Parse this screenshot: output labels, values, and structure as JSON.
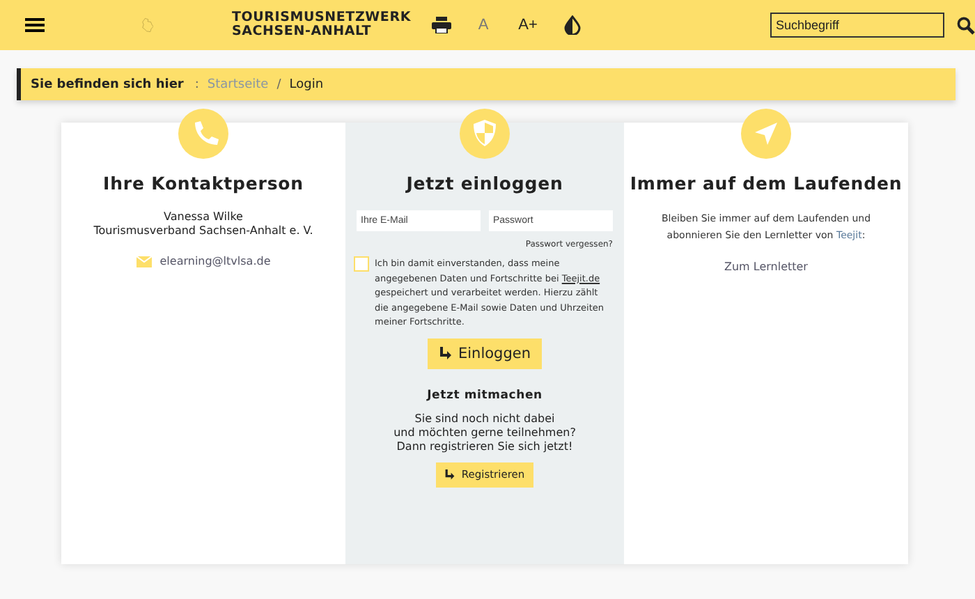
{
  "header": {
    "title_lines": [
      "TOURISMUSNETZWERK",
      "SACHSEN-ANHALT"
    ],
    "font_buttons": [
      "A",
      "A+"
    ],
    "search": {
      "placeholder": "Suchbegriff"
    }
  },
  "breadcrumb": {
    "label": "Sie befinden sich hier",
    "separator": ":",
    "items": [
      {
        "text": "Startseite",
        "kind": "link"
      },
      {
        "text": "/",
        "kind": "separator"
      },
      {
        "text": "Login",
        "kind": "current"
      }
    ]
  },
  "contact": {
    "title": "Ihre Kontaktperson",
    "lines": [
      "Vanessa Wilke",
      "Tourismusverband Sachsen-Anhalt e. V."
    ],
    "email": "elearning@ltvlsa.de"
  },
  "login": {
    "title": "Jetzt einloggen",
    "email_placeholder": "Ihre E-Mail",
    "password_placeholder": "Passwort",
    "forgot": "Passwort vergessen?",
    "consent": {
      "checked": false,
      "before": "Ich bin damit einverstanden, dass meine angegebenen Daten und Fortschritte bei ",
      "link": "Teejit.de",
      "after": " gespeichert und verarbeitet werden. Hierzu zählt die angegebene E-Mail sowie Daten und Uhrzeiten meiner Fortschritte."
    },
    "button": "Einloggen",
    "join_title": "Jetzt mitmachen",
    "join_lines": [
      "Sie sind noch nicht dabei",
      "und möchten gerne teilnehmen?",
      "Dann registrieren Sie sich jetzt!"
    ],
    "register_button": "Registrieren"
  },
  "newsletter": {
    "title": "Immer auf dem Laufenden",
    "text_before": "Bleiben Sie immer auf dem Laufenden und abonnieren Sie den Lernletter von ",
    "link": "Teejit",
    "text_after": ":",
    "cta": "Zum Lernletter"
  }
}
